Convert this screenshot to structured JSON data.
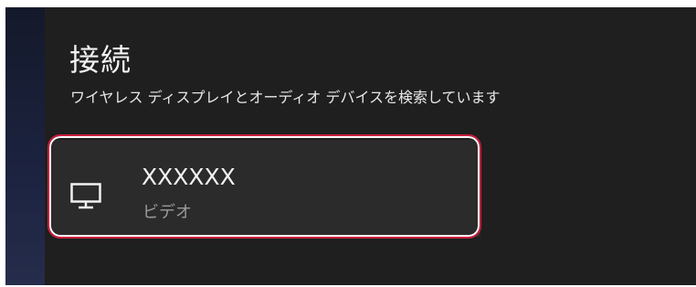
{
  "panel": {
    "title": "接続",
    "subtitle": "ワイヤレス ディスプレイとオーディオ デバイスを検索しています"
  },
  "devices": [
    {
      "name": "XXXXXX",
      "type": "ビデオ",
      "icon": "monitor-icon"
    }
  ],
  "colors": {
    "panel_background": "#1f1f1f",
    "card_background": "#2b2b2b",
    "highlight": "#c81e3c"
  }
}
